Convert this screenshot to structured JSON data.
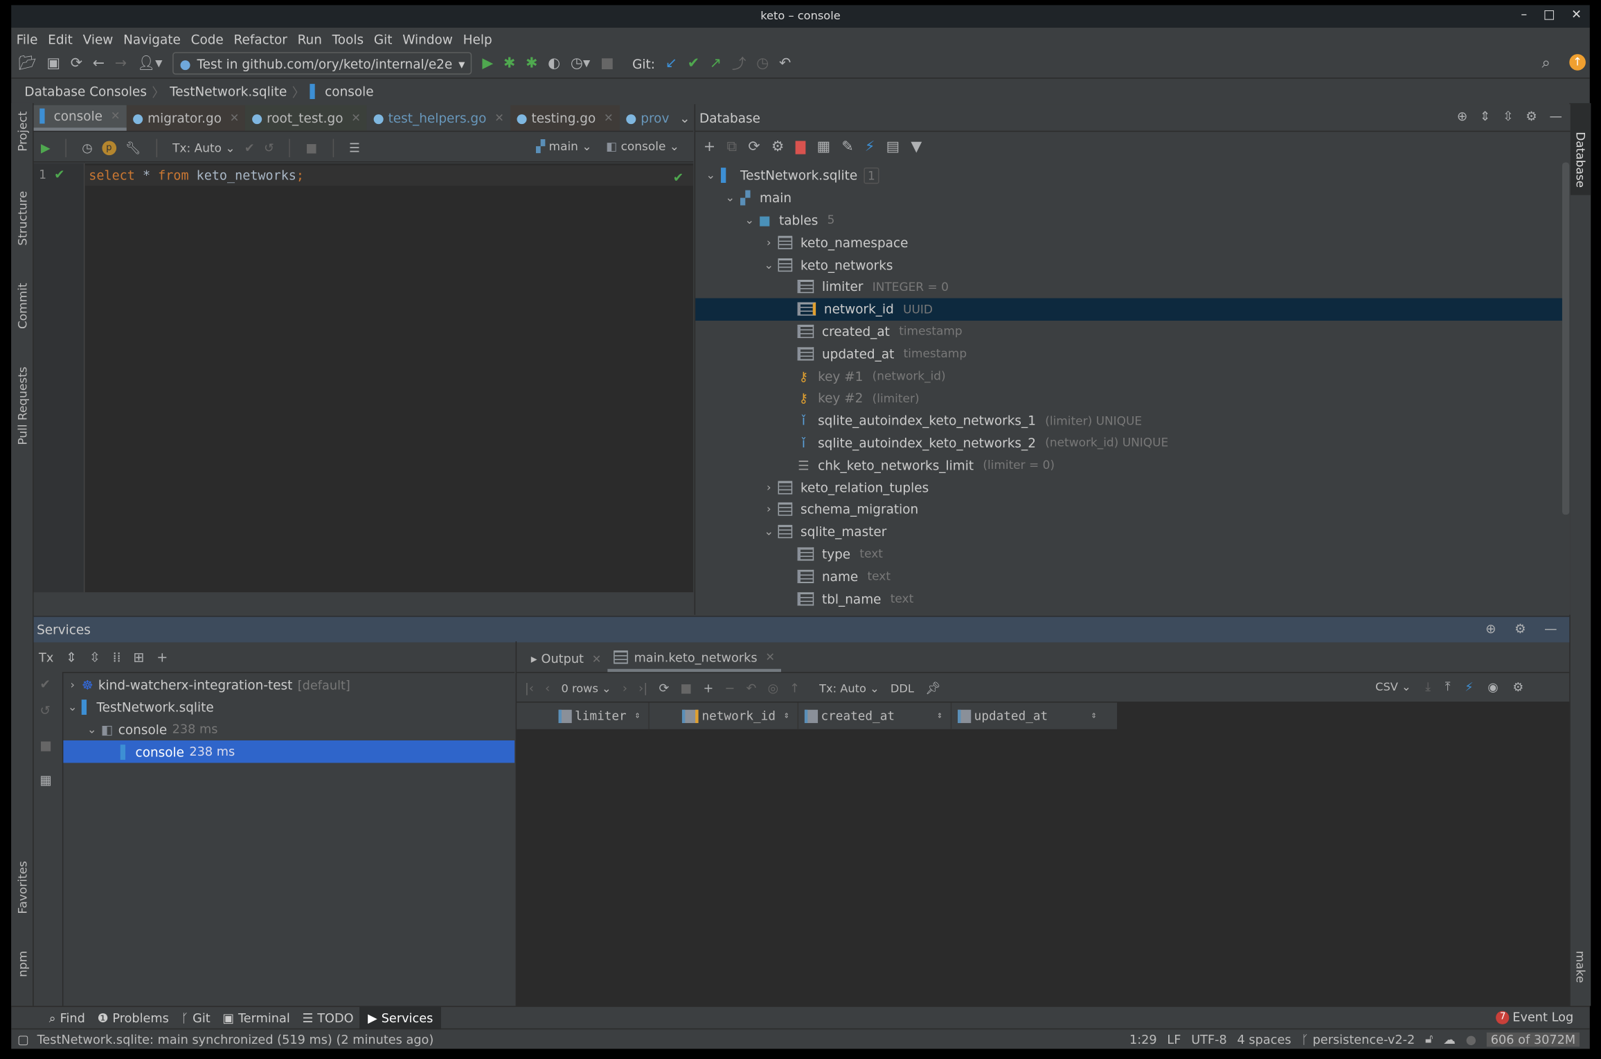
{
  "window": {
    "title": "keto – console",
    "controls": [
      "minimize",
      "maximize",
      "close"
    ]
  },
  "menu": [
    "File",
    "Edit",
    "View",
    "Navigate",
    "Code",
    "Refactor",
    "Run",
    "Tools",
    "Git",
    "Window",
    "Help"
  ],
  "toolbar": {
    "run_config": "Test in github.com/ory/keto/internal/e2e",
    "git_label": "Git:"
  },
  "breadcrumb": [
    "Database Consoles",
    "TestNetwork.sqlite",
    "console"
  ],
  "editor_tabs": [
    {
      "label": "console",
      "active": true
    },
    {
      "label": "migrator.go"
    },
    {
      "label": "root_test.go"
    },
    {
      "label": "test_helpers.go"
    },
    {
      "label": "testing.go"
    },
    {
      "label": "prov"
    }
  ],
  "editor_toolbar": {
    "tx": "Tx: Auto",
    "schema": "main",
    "session": "console"
  },
  "editor": {
    "line_number": "1",
    "kw1": "select",
    "star": " * ",
    "kw2": "from",
    "table": " keto_networks",
    "semi": ";"
  },
  "left_stripe": [
    "Project",
    "Structure",
    "Commit",
    "Pull Requests",
    "Favorites",
    "npm"
  ],
  "right_stripe": [
    "Database",
    "make"
  ],
  "database": {
    "title": "Database",
    "tree": [
      {
        "level": 0,
        "label": "TestNetwork.sqlite",
        "extra": "1",
        "icon": "sqlite-icon",
        "expanded": true
      },
      {
        "level": 1,
        "label": "main",
        "icon": "schema-icon",
        "expanded": true
      },
      {
        "level": 2,
        "label": "tables",
        "extra": "5",
        "icon": "folder-icon",
        "expanded": true
      },
      {
        "level": 3,
        "label": "keto_namespace",
        "icon": "table-icon",
        "expanded": false
      },
      {
        "level": 3,
        "label": "keto_networks",
        "icon": "table-icon",
        "expanded": true
      },
      {
        "level": 4,
        "label": "limiter",
        "extra": "INTEGER = 0",
        "icon": "column-icon"
      },
      {
        "level": 4,
        "label": "network_id",
        "extra": "UUID",
        "icon": "pk-column-icon",
        "selected": true
      },
      {
        "level": 4,
        "label": "created_at",
        "extra": "timestamp",
        "icon": "column-icon"
      },
      {
        "level": 4,
        "label": "updated_at",
        "extra": "timestamp",
        "icon": "column-icon"
      },
      {
        "level": 4,
        "label": "key #1",
        "extra": "(network_id)",
        "icon": "key-icon",
        "muted": true
      },
      {
        "level": 4,
        "label": "key #2",
        "extra": "(limiter)",
        "icon": "key-icon",
        "muted": true
      },
      {
        "level": 4,
        "label": "sqlite_autoindex_keto_networks_1",
        "extra": "(limiter) UNIQUE",
        "icon": "index-icon"
      },
      {
        "level": 4,
        "label": "sqlite_autoindex_keto_networks_2",
        "extra": "(network_id) UNIQUE",
        "icon": "index-icon"
      },
      {
        "level": 4,
        "label": "chk_keto_networks_limit",
        "extra": "(limiter = 0)",
        "icon": "check-icon"
      },
      {
        "level": 3,
        "label": "keto_relation_tuples",
        "icon": "table-icon",
        "expanded": false
      },
      {
        "level": 3,
        "label": "schema_migration",
        "icon": "table-icon",
        "expanded": false
      },
      {
        "level": 3,
        "label": "sqlite_master",
        "icon": "table-icon",
        "expanded": true
      },
      {
        "level": 4,
        "label": "type",
        "extra": "text",
        "icon": "column-icon"
      },
      {
        "level": 4,
        "label": "name",
        "extra": "text",
        "icon": "column-icon"
      },
      {
        "level": 4,
        "label": "tbl_name",
        "extra": "text",
        "icon": "column-icon"
      }
    ]
  },
  "services": {
    "title": "Services",
    "tx": "Tx",
    "tree": [
      {
        "level": 0,
        "label": "kind-watcherx-integration-test",
        "extra": "[default]"
      },
      {
        "level": 0,
        "label": "TestNetwork.sqlite"
      },
      {
        "level": 1,
        "label": "console",
        "extra": "238 ms"
      },
      {
        "level": 2,
        "label": "console",
        "extra": "238 ms",
        "selected": true
      }
    ],
    "tabs": [
      {
        "label": "Output"
      },
      {
        "label": "main.keto_networks",
        "active": true
      }
    ],
    "result_toolbar": {
      "rows": "0 rows",
      "tx": "Tx: Auto",
      "ddl": "DDL",
      "format": "CSV"
    },
    "columns": [
      "limiter",
      "network_id",
      "created_at",
      "updated_at"
    ]
  },
  "bottom_tools": [
    "Find",
    "Problems",
    "Git",
    "Terminal",
    "TODO",
    "Services"
  ],
  "event_log": {
    "count": "7",
    "label": "Event Log"
  },
  "status": {
    "message": "TestNetwork.sqlite: main synchronized (519 ms) (2 minutes ago)",
    "position": "1:29",
    "line_sep": "LF",
    "encoding": "UTF-8",
    "indent": "4 spaces",
    "branch": "persistence-v2-2",
    "memory": "606 of 3072M"
  },
  "colors": {
    "bg": "#3c3f41",
    "editor_bg": "#2b2b2b",
    "selection": "#2f65ca",
    "tree_selection": "#0d293e",
    "keyword": "#cc7832",
    "services_header": "#3d4b5c"
  }
}
